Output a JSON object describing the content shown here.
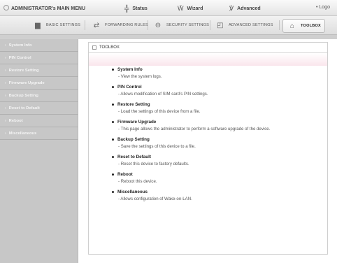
{
  "header": {
    "title": "ADMINISTRATOR's MAIN MENU",
    "nav": [
      {
        "label": "Status",
        "icon": "status-icon"
      },
      {
        "label": "Wizard",
        "icon": "wizard-icon"
      },
      {
        "label": "Advanced",
        "icon": "advanced-icon"
      }
    ],
    "logout": "• Logo"
  },
  "tabs": [
    {
      "label": "BASIC SETTINGS",
      "icon": "basic-settings-icon"
    },
    {
      "label": "FORWARDING RULES",
      "icon": "forwarding-rules-icon"
    },
    {
      "label": "SECURITY SETTINGS",
      "icon": "security-settings-icon"
    },
    {
      "label": "ADVANCED SETTINGS",
      "icon": "advanced-settings-icon"
    },
    {
      "label": "TOOLBOX",
      "icon": "toolbox-icon",
      "active": true
    }
  ],
  "sidebar": {
    "items": [
      {
        "label": "System Info"
      },
      {
        "label": "PIN Control"
      },
      {
        "label": "Restore Setting"
      },
      {
        "label": "Firmware Upgrade"
      },
      {
        "label": "Backup Setting"
      },
      {
        "label": "Reset to Default"
      },
      {
        "label": "Reboot"
      },
      {
        "label": "Miscellaneous"
      }
    ]
  },
  "panel": {
    "title": "TOOLBOX",
    "entries": [
      {
        "title": "System Info",
        "desc": "- View the system logs."
      },
      {
        "title": "PIN Control",
        "desc": "- Allows modification of SIM card's PIN settings."
      },
      {
        "title": "Restore Setting",
        "desc": "- Load the settings of this device from a file."
      },
      {
        "title": "Firmware Upgrade",
        "desc": "- This page allows the administrator to perform a software upgrade of the device."
      },
      {
        "title": "Backup Setting",
        "desc": "- Save the settings of this device to a file."
      },
      {
        "title": "Reset to Default",
        "desc": "- Reset this device to factory defaults."
      },
      {
        "title": "Reboot",
        "desc": "- Reboot this device."
      },
      {
        "title": "Miscellaneous",
        "desc": "- Allows configuration of Wake-on-LAN."
      }
    ]
  },
  "colors": {
    "sidebar_bg": "#c7c7c7",
    "panel_band": "#fae6ec"
  }
}
